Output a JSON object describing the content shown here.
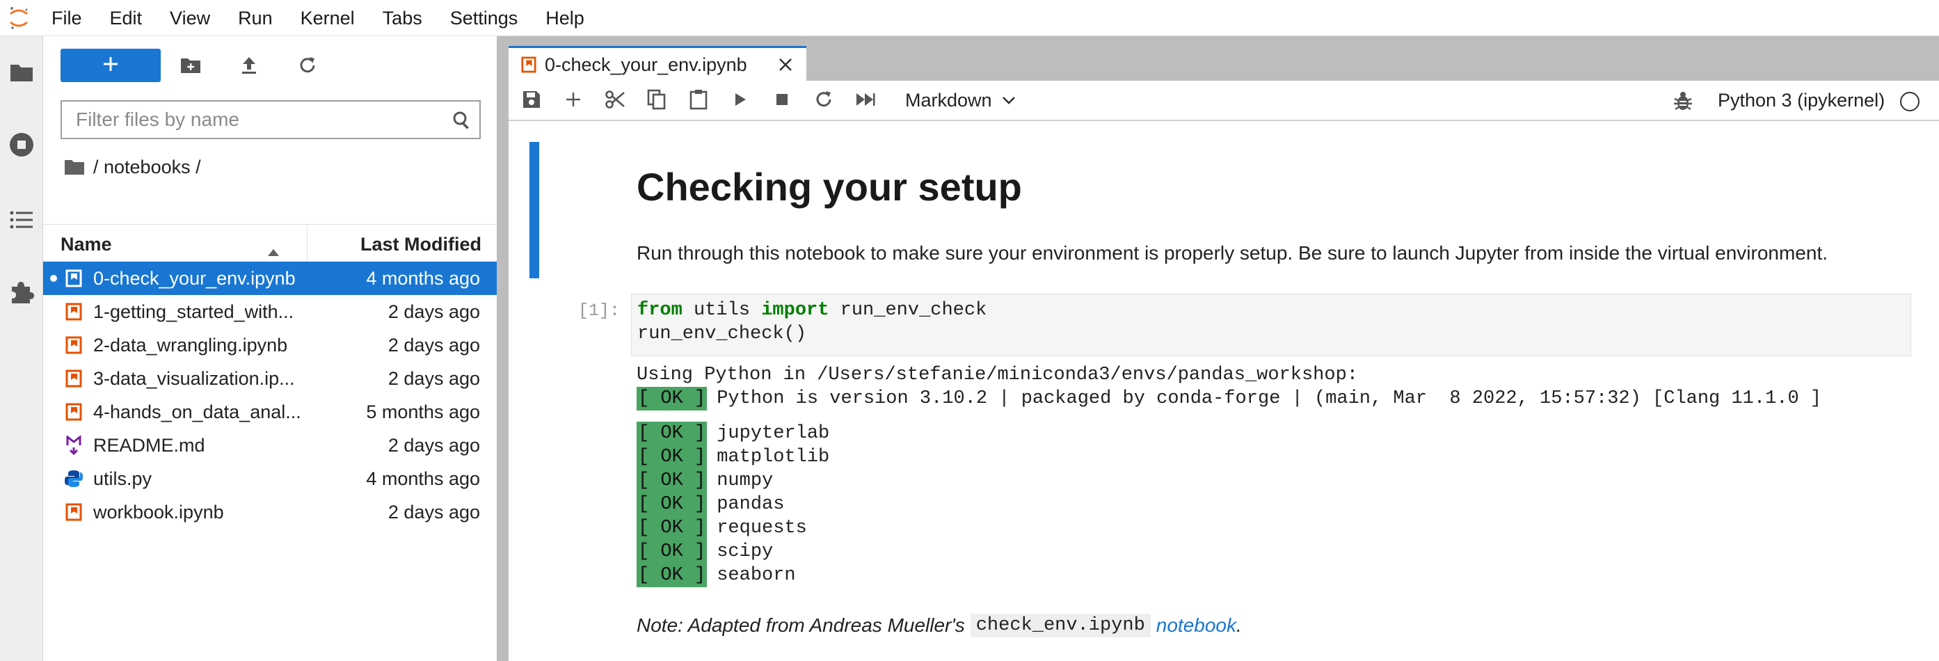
{
  "menubar": {
    "items": [
      "File",
      "Edit",
      "View",
      "Run",
      "Kernel",
      "Tabs",
      "Settings",
      "Help"
    ]
  },
  "activity_bar": {
    "icons": [
      "folder-icon",
      "stop-circle-icon",
      "list-icon",
      "puzzle-icon"
    ]
  },
  "file_browser": {
    "filter_placeholder": "Filter files by name",
    "breadcrumb": "/ notebooks /",
    "columns": {
      "name": "Name",
      "modified": "Last Modified"
    },
    "files": [
      {
        "name": "0-check_your_env.ipynb",
        "modified": "4 months ago",
        "type": "notebook",
        "selected": true
      },
      {
        "name": "1-getting_started_with...",
        "modified": "2 days ago",
        "type": "notebook"
      },
      {
        "name": "2-data_wrangling.ipynb",
        "modified": "2 days ago",
        "type": "notebook"
      },
      {
        "name": "3-data_visualization.ip...",
        "modified": "2 days ago",
        "type": "notebook"
      },
      {
        "name": "4-hands_on_data_anal...",
        "modified": "5 months ago",
        "type": "notebook"
      },
      {
        "name": "README.md",
        "modified": "2 days ago",
        "type": "markdown"
      },
      {
        "name": "utils.py",
        "modified": "4 months ago",
        "type": "python"
      },
      {
        "name": "workbook.ipynb",
        "modified": "2 days ago",
        "type": "notebook"
      }
    ]
  },
  "tab": {
    "label": "0-check_your_env.ipynb"
  },
  "notebook_toolbar": {
    "cell_type": "Markdown",
    "kernel": "Python 3 (ipykernel)"
  },
  "notebook": {
    "heading": "Checking your setup",
    "paragraph": "Run through this notebook to make sure your environment is properly setup. Be sure to launch Jupyter from inside the virtual environment.",
    "prompt": "[1]:",
    "code": {
      "kw_from": "from",
      "module": " utils ",
      "kw_import": "import",
      "name": " run_env_check",
      "line2": "run_env_check()"
    },
    "output": {
      "line1": "Using Python in /Users/stefanie/miniconda3/envs/pandas_workshop:",
      "ok_tag": "[ OK ]",
      "python_line": "Python is version 3.10.2 | packaged by conda-forge | (main, Mar  8 2022, 15:57:32) [Clang 11.1.0 ]",
      "packages": [
        "jupyterlab",
        "matplotlib",
        "numpy",
        "pandas",
        "requests",
        "scipy",
        "seaborn"
      ]
    },
    "note": {
      "prefix": "Note: Adapted from Andreas Mueller's",
      "code": "check_env.ipynb",
      "link": "notebook",
      "suffix": "."
    }
  },
  "colors": {
    "accent": "#1976d2",
    "ok_green": "#4aa463",
    "notebook_icon": "#e65100",
    "keyword_green": "#008000"
  }
}
